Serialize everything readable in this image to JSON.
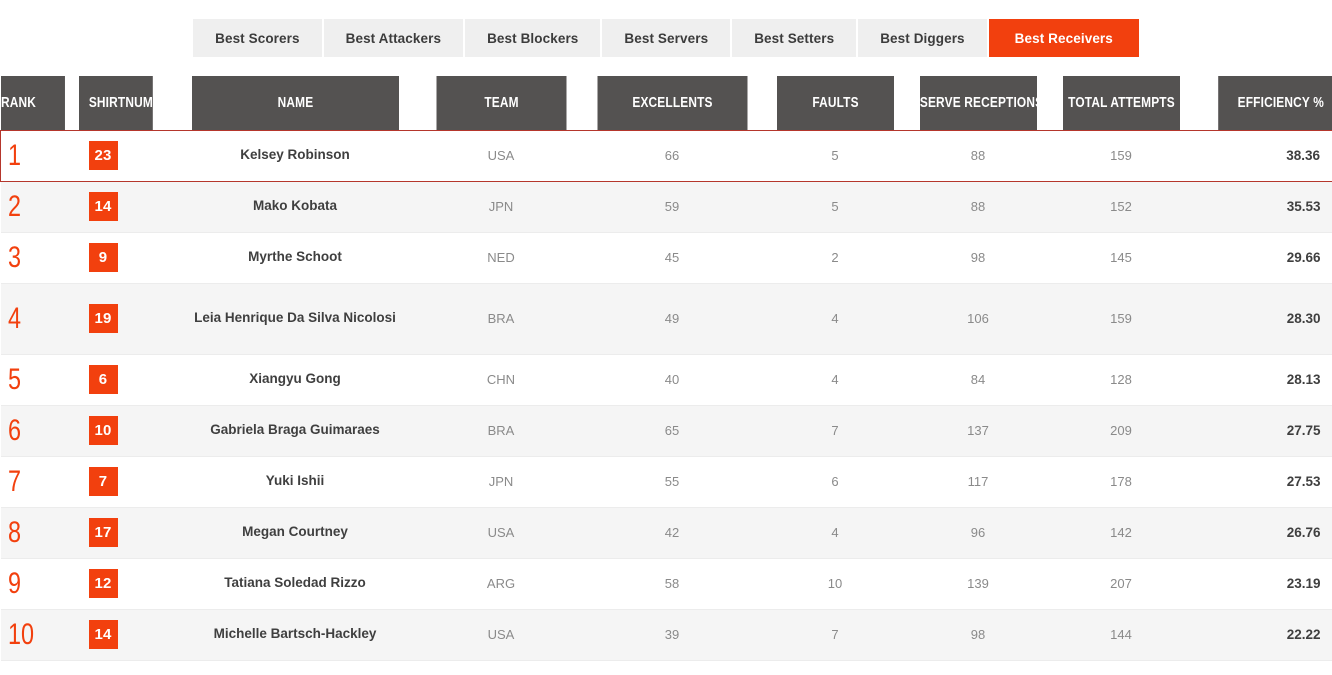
{
  "colors": {
    "accent_orange": "#f2400e",
    "header_bar": "#545251",
    "tab_inactive_bg": "#efefef",
    "highlight_border": "#b5362c",
    "row_alt_bg": "#f5f5f5"
  },
  "tabs": [
    {
      "label": "Best Scorers",
      "active": false
    },
    {
      "label": "Best Attackers",
      "active": false
    },
    {
      "label": "Best Blockers",
      "active": false
    },
    {
      "label": "Best Servers",
      "active": false
    },
    {
      "label": "Best Setters",
      "active": false
    },
    {
      "label": "Best Diggers",
      "active": false
    },
    {
      "label": "Best Receivers",
      "active": true
    }
  ],
  "table": {
    "columns": [
      "RANK",
      "SHIRTNUMBER",
      "NAME",
      "TEAM",
      "EXCELLENTS",
      "FAULTS",
      "SERVE RECEPTIONS",
      "TOTAL ATTEMPTS",
      "EFFICIENCY %"
    ],
    "rows": [
      {
        "rank": "1",
        "shirt": "23",
        "name": "Kelsey Robinson",
        "team": "USA",
        "excellents": "66",
        "faults": "5",
        "serve_receptions": "88",
        "total_attempts": "159",
        "efficiency": "38.36"
      },
      {
        "rank": "2",
        "shirt": "14",
        "name": "Mako Kobata",
        "team": "JPN",
        "excellents": "59",
        "faults": "5",
        "serve_receptions": "88",
        "total_attempts": "152",
        "efficiency": "35.53"
      },
      {
        "rank": "3",
        "shirt": "9",
        "name": "Myrthe Schoot",
        "team": "NED",
        "excellents": "45",
        "faults": "2",
        "serve_receptions": "98",
        "total_attempts": "145",
        "efficiency": "29.66"
      },
      {
        "rank": "4",
        "shirt": "19",
        "name": "Leia Henrique Da Silva Nicolosi",
        "team": "BRA",
        "excellents": "49",
        "faults": "4",
        "serve_receptions": "106",
        "total_attempts": "159",
        "efficiency": "28.30"
      },
      {
        "rank": "5",
        "shirt": "6",
        "name": "Xiangyu Gong",
        "team": "CHN",
        "excellents": "40",
        "faults": "4",
        "serve_receptions": "84",
        "total_attempts": "128",
        "efficiency": "28.13"
      },
      {
        "rank": "6",
        "shirt": "10",
        "name": "Gabriela Braga Guimaraes",
        "team": "BRA",
        "excellents": "65",
        "faults": "7",
        "serve_receptions": "137",
        "total_attempts": "209",
        "efficiency": "27.75"
      },
      {
        "rank": "7",
        "shirt": "7",
        "name": "Yuki Ishii",
        "team": "JPN",
        "excellents": "55",
        "faults": "6",
        "serve_receptions": "117",
        "total_attempts": "178",
        "efficiency": "27.53"
      },
      {
        "rank": "8",
        "shirt": "17",
        "name": "Megan Courtney",
        "team": "USA",
        "excellents": "42",
        "faults": "4",
        "serve_receptions": "96",
        "total_attempts": "142",
        "efficiency": "26.76"
      },
      {
        "rank": "9",
        "shirt": "12",
        "name": "Tatiana Soledad Rizzo",
        "team": "ARG",
        "excellents": "58",
        "faults": "10",
        "serve_receptions": "139",
        "total_attempts": "207",
        "efficiency": "23.19"
      },
      {
        "rank": "10",
        "shirt": "14",
        "name": "Michelle Bartsch-Hackley",
        "team": "USA",
        "excellents": "39",
        "faults": "7",
        "serve_receptions": "98",
        "total_attempts": "144",
        "efficiency": "22.22"
      }
    ]
  }
}
